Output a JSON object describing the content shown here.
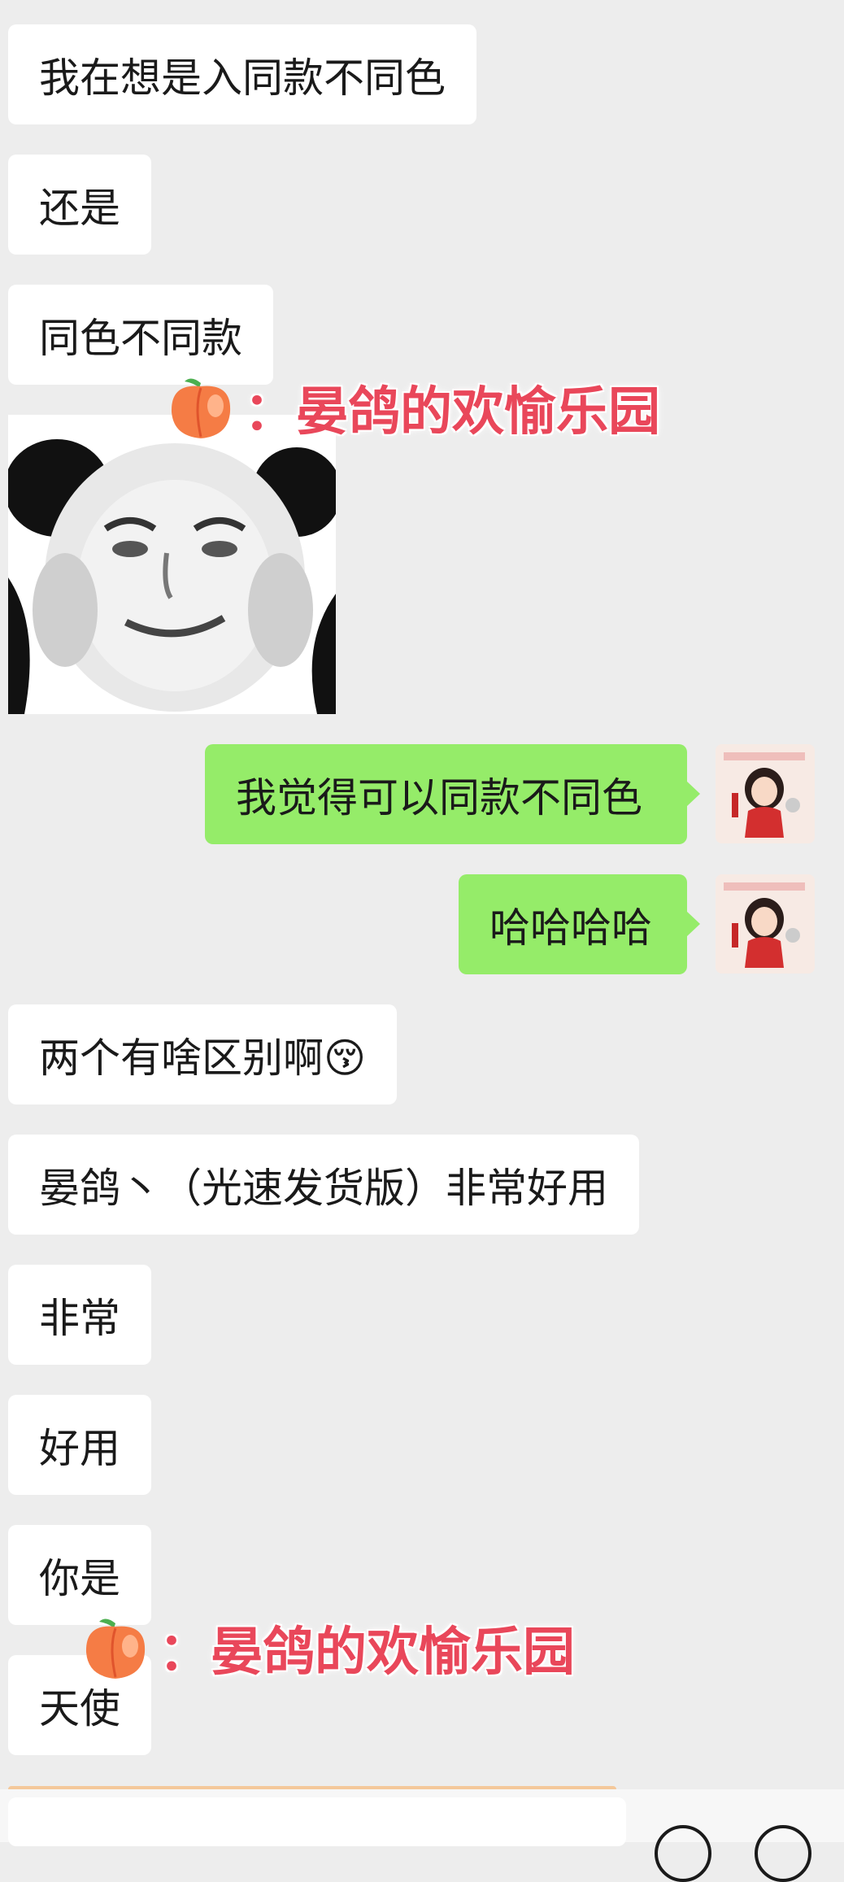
{
  "messages": [
    {
      "side": "left",
      "text": "我在想是入同款不同色"
    },
    {
      "side": "left",
      "text": "还是"
    },
    {
      "side": "left",
      "text": "同色不同款"
    },
    {
      "side": "left",
      "type": "sticker",
      "sticker": "panda-face-meme"
    },
    {
      "side": "right",
      "text": "我觉得可以同款不同色"
    },
    {
      "side": "right",
      "text": "哈哈哈哈"
    },
    {
      "side": "left",
      "text": "两个有啥区别啊😚"
    },
    {
      "side": "left",
      "text": "晏鸽丶（光速发货版）非常好用"
    },
    {
      "side": "left",
      "text": "非常"
    },
    {
      "side": "left",
      "text": "好用"
    },
    {
      "side": "left",
      "text": "你是"
    },
    {
      "side": "left",
      "text": "天使"
    }
  ],
  "watermark": {
    "text": "：晏鸽的欢愉乐园",
    "icon": "peach-icon"
  },
  "colors": {
    "background": "#ededed",
    "sent_bubble": "#95ec69",
    "received_bubble": "#ffffff",
    "watermark": "#e9475a"
  }
}
